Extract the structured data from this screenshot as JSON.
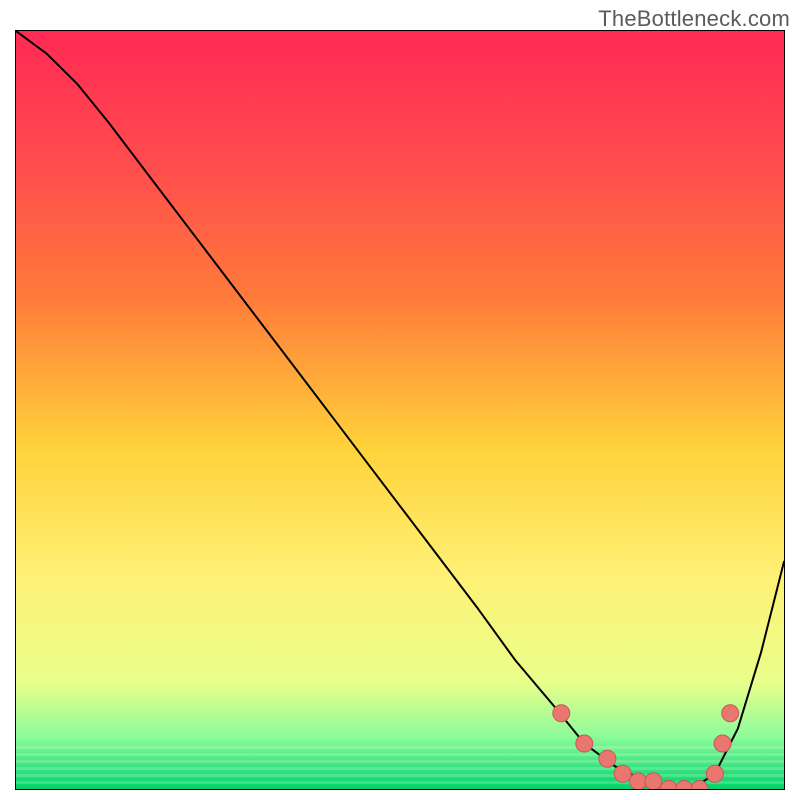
{
  "watermark": "TheBottleneck.com",
  "colors": {
    "grad_top": "#ff2a55",
    "grad_mid1": "#ff7a3a",
    "grad_mid2": "#ffd23a",
    "grad_mid3": "#fff176",
    "grad_low1": "#e8ff8a",
    "grad_low2": "#8dfc9a",
    "grad_bottom": "#00d36b",
    "curve": "#000000",
    "marker_fill": "#e9766f",
    "marker_stroke": "#c85a54"
  },
  "chart_data": {
    "type": "line",
    "title": "",
    "xlabel": "",
    "ylabel": "",
    "xlim": [
      0,
      100
    ],
    "ylim": [
      0,
      100
    ],
    "series": [
      {
        "name": "bottleneck-curve",
        "x": [
          0,
          4,
          8,
          12,
          18,
          24,
          30,
          36,
          42,
          48,
          54,
          60,
          65,
          70,
          74,
          78,
          82,
          85,
          88,
          91,
          94,
          97,
          100
        ],
        "y": [
          100,
          97,
          93,
          88,
          80,
          72,
          64,
          56,
          48,
          40,
          32,
          24,
          17,
          11,
          6,
          3,
          1,
          0,
          0,
          2,
          8,
          18,
          30
        ]
      }
    ],
    "markers": {
      "name": "highlighted-points",
      "x": [
        71,
        74,
        77,
        79,
        81,
        83,
        85,
        87,
        89,
        91,
        92,
        93
      ],
      "y": [
        10,
        6,
        4,
        2,
        1,
        1,
        0,
        0,
        0,
        2,
        6,
        10
      ]
    }
  }
}
